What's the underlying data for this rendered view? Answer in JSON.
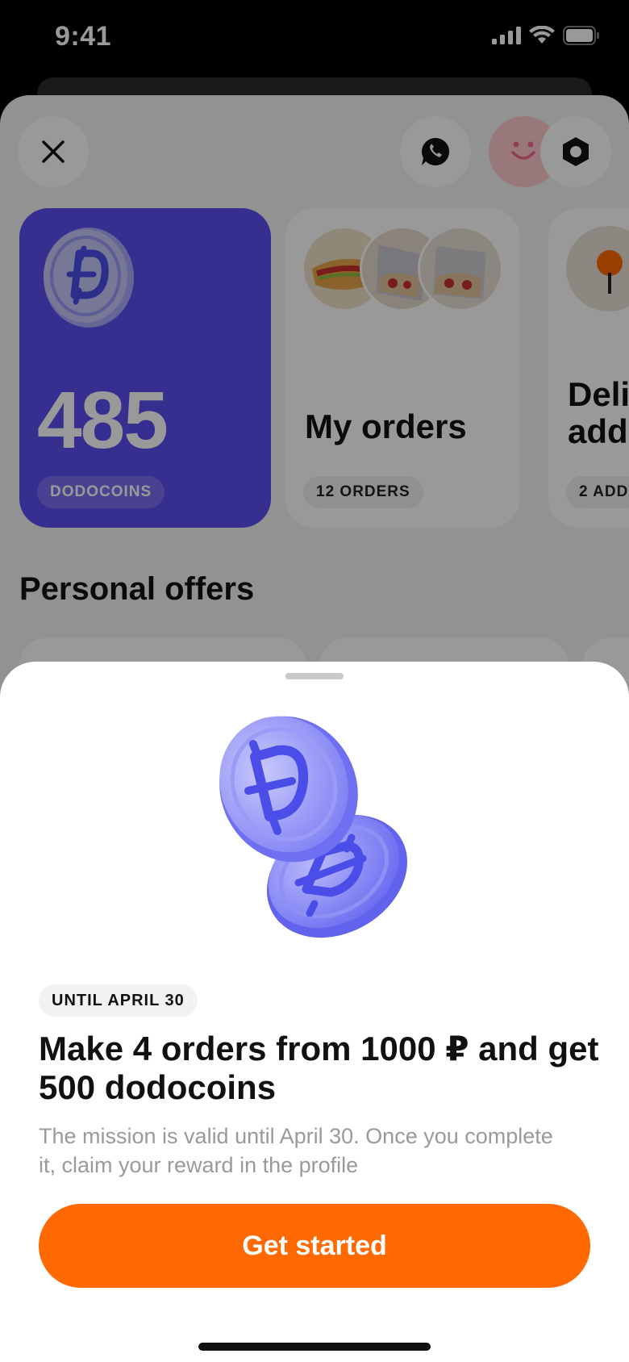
{
  "status_bar": {
    "time": "9:41"
  },
  "profile": {
    "coins_card": {
      "value": "485",
      "label": "DODOCOINS"
    },
    "orders_card": {
      "title": "My orders",
      "badge": "12 ORDERS"
    },
    "delivery_card": {
      "title_line1": "Deli",
      "title_line2": "add",
      "badge": "2 ADD"
    },
    "section_title": "Personal offers"
  },
  "sheet": {
    "badge": "UNTIL APRIL 30",
    "title": "Make 4 orders from 1000 ₽ and get 500 dodocoins",
    "description": "The mission is valid until April 30. Once you complete it, claim your reward in the profile",
    "cta_label": "Get started"
  },
  "colors": {
    "accent": "#ff6900",
    "coin_card": "#5b4ff0",
    "coin": "#7b7cf5"
  },
  "icons": [
    "close-icon",
    "chat-icon",
    "avatar-smile-icon",
    "settings-icon",
    "coin-icon",
    "location-pin-icon"
  ]
}
